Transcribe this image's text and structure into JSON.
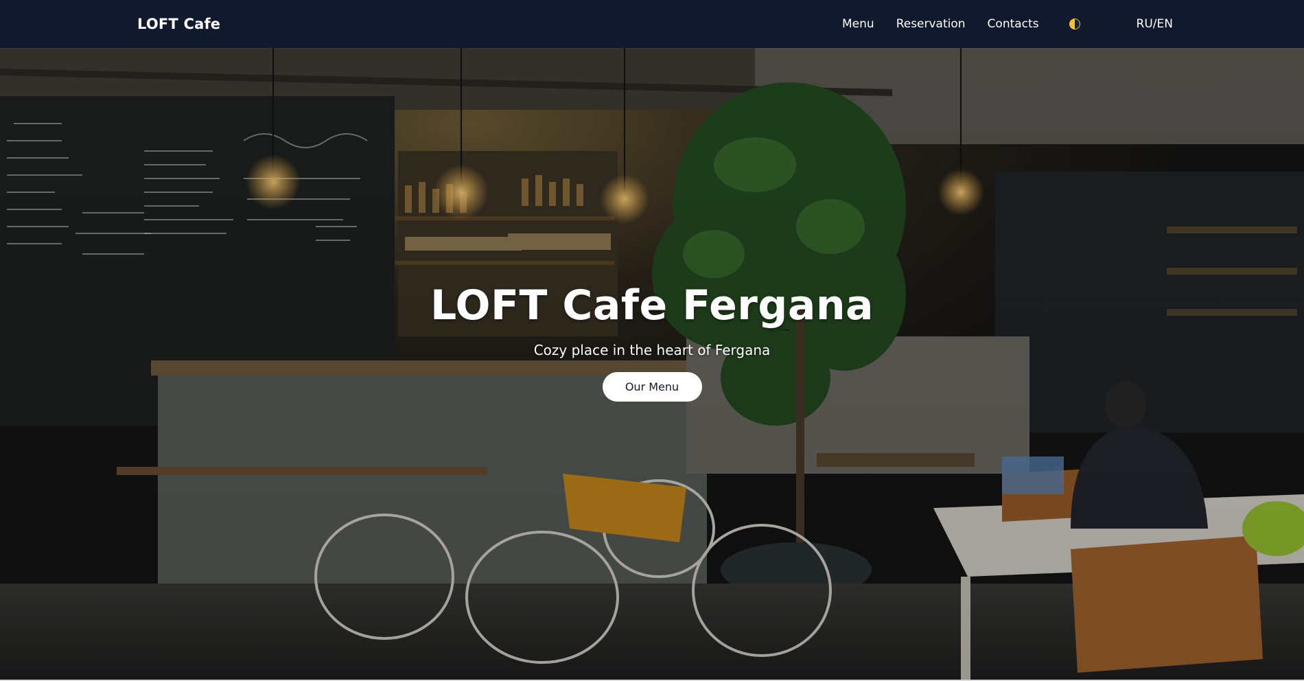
{
  "header": {
    "brand": "LOFT Cafe",
    "nav": {
      "menu": "Menu",
      "reservation": "Reservation",
      "contacts": "Contacts"
    },
    "theme_icon": "half-moon-icon",
    "language": "RU/EN"
  },
  "hero": {
    "title": "LOFT Cafe Fergana",
    "subtitle": "Cozy place in the heart of Fergana",
    "button": "Our Menu",
    "background": "cafe-interior-photo"
  },
  "colors": {
    "header_bg": "#111a2c",
    "button_bg": "#ffffff",
    "accent": "#f1c232"
  }
}
